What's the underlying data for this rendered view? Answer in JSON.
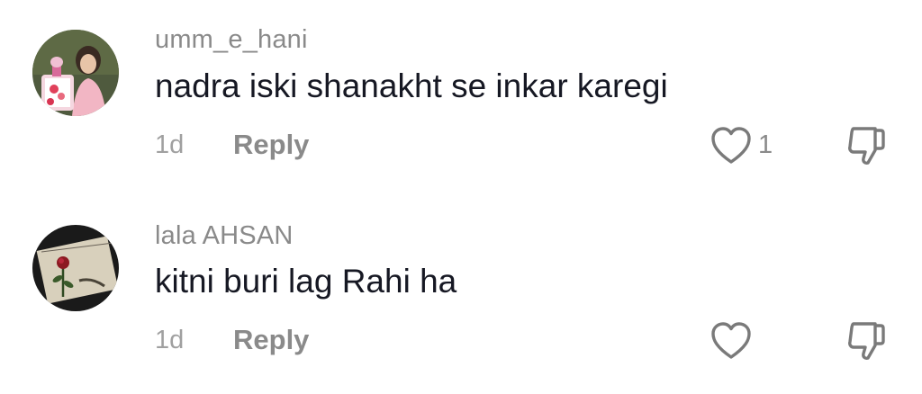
{
  "comments": [
    {
      "username": "umm_e_hani",
      "text": "nadra iski shanakht se inkar karegi",
      "time": "1d",
      "reply_label": "Reply",
      "like_count": "1",
      "like_icon": "heart-outline-icon",
      "dislike_icon": "thumbs-down-icon"
    },
    {
      "username": "lala AHSAN",
      "text": "kitni buri lag Rahi ha",
      "time": "1d",
      "reply_label": "Reply",
      "like_count": "",
      "like_icon": "heart-outline-icon",
      "dislike_icon": "thumbs-down-icon"
    }
  ],
  "colors": {
    "username": "#8a8a8a",
    "text": "#161823",
    "meta": "#a0a0a0",
    "icon": "#7a7a7a"
  }
}
